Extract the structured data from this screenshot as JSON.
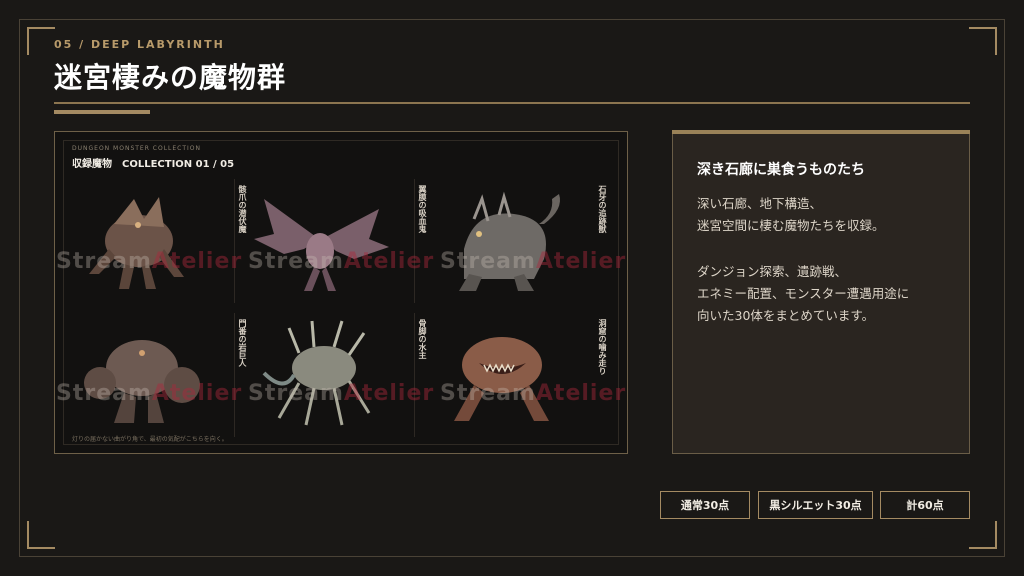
{
  "header": {
    "kicker": "05 / DEEP LABYRINTH",
    "title": "迷宮棲みの魔物群"
  },
  "gallery": {
    "subtitle": "DUNGEON MONSTER COLLECTION",
    "heading": "収録魔物",
    "collection": "COLLECTION 01 / 05",
    "footer": "灯りの届かない曲がり角で、最初の気配がこちらを向く。",
    "watermark_a": "Stream",
    "watermark_b": "Atelier",
    "monsters": [
      {
        "label": "骸爪の潜伏魔",
        "icon": "clawed-ghoul-icon"
      },
      {
        "label": "翼膜の吸血鬼",
        "icon": "winged-bat-demon-icon"
      },
      {
        "label": "石牙の追跡獣",
        "icon": "stone-beast-icon"
      },
      {
        "label": "門番の岩巨人",
        "icon": "rock-golem-icon"
      },
      {
        "label": "骨脚の水主",
        "icon": "bone-crawler-icon"
      },
      {
        "label": "洞窟の噛み走り",
        "icon": "fanged-toad-icon"
      }
    ]
  },
  "panel": {
    "heading": "深き石廊に巣食うものたち",
    "para1_line1": "深い石廊、地下構造、",
    "para1_line2": "迷宮空間に棲む魔物たちを収録。",
    "para2_line1": "ダンジョン探索、遺跡戦、",
    "para2_line2": "エネミー配置、モンスター遭遇用途に",
    "para2_line3": "向いた30体をまとめています。"
  },
  "chips": {
    "normal": "通常30点",
    "silhouette": "黒シルエット30点",
    "total": "計60点"
  },
  "colors": {
    "background": "#1a1816",
    "accent_gold": "#a48a62",
    "panel_bg": "#2a2520"
  }
}
